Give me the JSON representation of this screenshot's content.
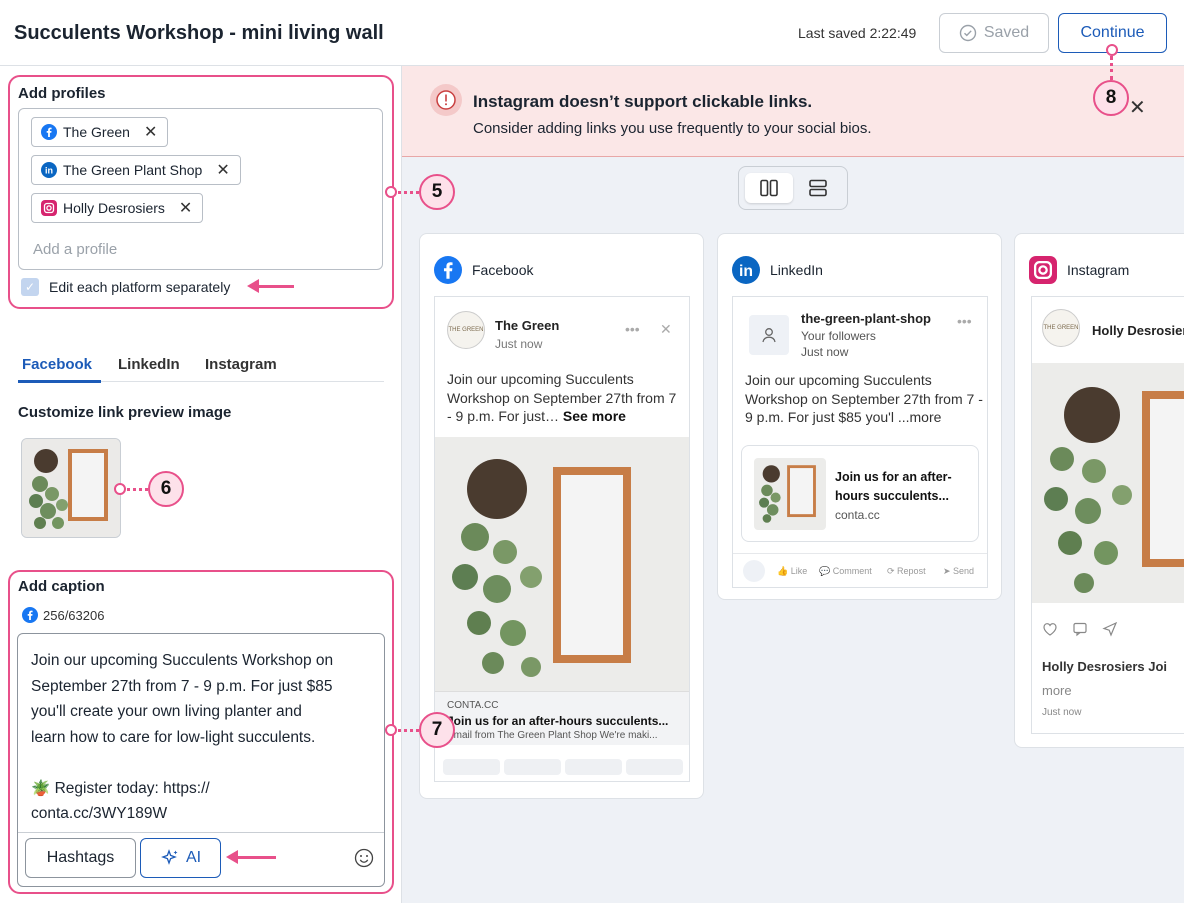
{
  "header": {
    "title": "Succulents Workshop - mini living wall",
    "last_saved": "Last saved 2:22:49",
    "saved_label": "Saved",
    "continue_label": "Continue"
  },
  "profiles": {
    "label": "Add profiles",
    "chips": [
      {
        "name": "The Green",
        "network": "facebook"
      },
      {
        "name": "The Green Plant Shop",
        "network": "linkedin"
      },
      {
        "name": "Holly Desrosiers",
        "network": "instagram"
      }
    ],
    "add_placeholder": "Add a profile",
    "edit_separately_label": "Edit each platform separately"
  },
  "platform_tabs": [
    "Facebook",
    "LinkedIn",
    "Instagram"
  ],
  "link_preview_label": "Customize link preview image",
  "caption": {
    "label": "Add caption",
    "counter": "256/63206",
    "text": "Join our upcoming Succulents Workshop on\nSeptember 27th from 7 - 9 p.m. For just $85\nyou'll create your own living planter and\nlearn how to care for low-light succulents.\n\n🪴 Register today: https://\nconta.cc/3WY189W",
    "hashtags_label": "Hashtags",
    "ai_label": "AI"
  },
  "banner": {
    "title": "Instagram doesn’t support clickable links.",
    "subtitle": "Consider adding links you use frequently to your social bios."
  },
  "previews": {
    "facebook": {
      "platform": "Facebook",
      "author": "The Green",
      "time": "Just now",
      "text": "Join our upcoming Succulents Workshop on September 27th from 7 - 9 p.m. For just…",
      "see_more": "See more",
      "link_domain": "CONTA.CC",
      "link_title": "Join us for an after-hours succulents...",
      "link_desc": "Email from The Green Plant Shop We're maki..."
    },
    "linkedin": {
      "platform": "LinkedIn",
      "author": "the-green-plant-shop",
      "audience": "Your followers",
      "time": "Just now",
      "text": "Join our upcoming Succulents Workshop on September 27th from 7 - 9 p.m. For just $85 you'l ...more",
      "link_title": "Join us for an after-hours succulents...",
      "link_domain": "conta.cc",
      "actions": [
        "Like",
        "Comment",
        "Repost",
        "Send"
      ]
    },
    "instagram": {
      "platform": "Instagram",
      "author": "Holly Desrosiers",
      "caption_start": "Holly Desrosiers Joi",
      "more": "more",
      "time": "Just now"
    }
  },
  "brand_logo_text": "THE GREEN",
  "callouts": [
    "5",
    "6",
    "7",
    "8"
  ],
  "colors": {
    "accent": "#1c5bb8",
    "callout": "#e8508a",
    "banner_bg": "#fbe7e7",
    "canvas_bg": "#eef1f6"
  }
}
